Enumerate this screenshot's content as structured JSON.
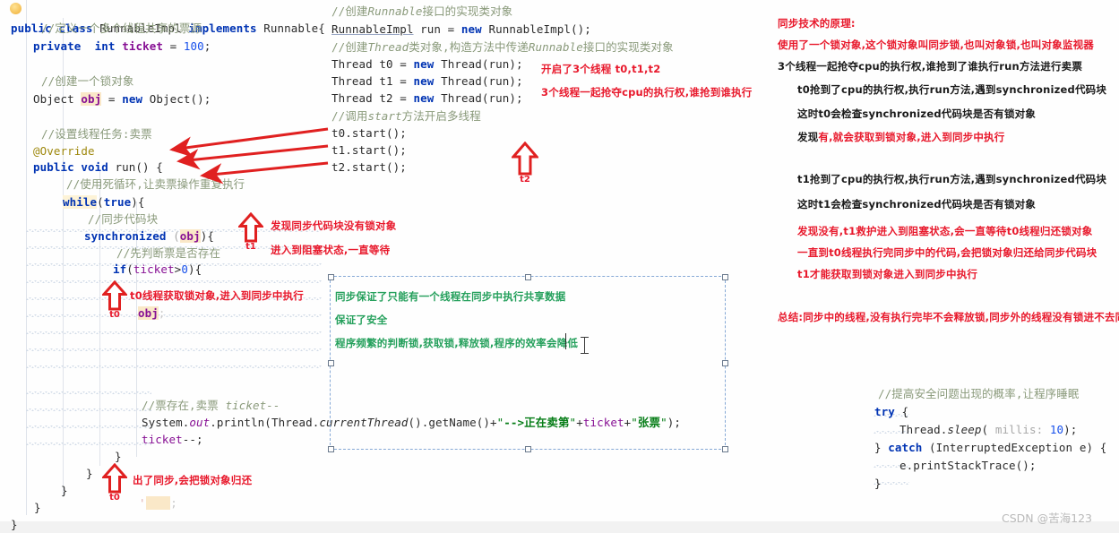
{
  "editor": {
    "left_code": [
      "public class RunnableImpl implements Runnable{",
      "    //定义一个多个线程共享的票源",
      "    private  int ticket = 100;",
      "",
      "    //创建一个锁对象",
      "    Object obj = new Object();",
      "",
      "    //设置线程任务:卖票",
      "    @Override",
      "    public void run() {",
      "        //使用死循环,让卖票操作重复执行",
      "        while(true){",
      "            //同步代码块",
      "            synchronized (obj){",
      "                //先判断票是否存在",
      "                if(ticket>0){",
      "",
      "                    //票存在,卖票 ticket--",
      "                    System.out.println(Thread.currentThread().getName()+\"-->正在卖第\"+ticket+\"张票\");",
      "                    ticket--;",
      "                }",
      "            }",
      "        }",
      "    }",
      "}"
    ],
    "middle_code": [
      "//创建Runnable接口的实现类对象",
      "RunnableImpl run = new RunnableImpl();",
      "//创建Thread类对象,构造方法中传递Runnable接口的实现类对象",
      "Thread t0 = new Thread(run);",
      "Thread t1 = new Thread(run);",
      "Thread t2 = new Thread(run);",
      "//调用start方法开启多线程",
      "t0.start();",
      "t1.start();",
      "t2.start();"
    ],
    "right_code": [
      "//提高安全问题出现的概率,让程序睡眠",
      "try {",
      "    Thread.sleep( millis: 10);",
      "} catch (InterruptedException e) {",
      "    e.printStackTrace();",
      "}"
    ],
    "sleep_param_hint": "millis:",
    "sleep_value": "10"
  },
  "annotations": {
    "middle_top": [
      "开启了3个线程 t0,t1,t2",
      "3个线程一起抢夺cpu的执行权,谁抢到谁执行"
    ],
    "t2_label": "t2",
    "t1_block": {
      "label": "t1",
      "lines": [
        "发现同步代码块没有锁对象",
        "进入到阻塞状态,一直等待"
      ]
    },
    "t0_lock": {
      "label": "t0",
      "text": "t0线程获取锁对象,进入到同步中执行",
      "code_hint": "obj"
    },
    "t0_release": {
      "label": "t0",
      "text": "出了同步,会把锁对象归还"
    }
  },
  "right_panel": {
    "title": "同步技术的原理:",
    "lines": [
      {
        "text": "使用了一个锁对象,这个锁对象叫同步锁,也叫对象锁,也叫对象监视器",
        "color": "red",
        "indent": 0
      },
      {
        "text": "3个线程一起抢夺cpu的执行权,谁抢到了谁执行run方法进行卖票",
        "color": "black",
        "indent": 0
      },
      {
        "text": "t0抢到了cpu的执行权,执行run方法,遇到synchronized代码块",
        "color": "black",
        "indent": 1
      },
      {
        "text": "这时t0会检查synchronized代码块是否有锁对象",
        "color": "black",
        "indent": 1
      },
      {
        "text": "发现有,就会获取到锁对象,进入到同步中执行",
        "color": "mixed",
        "indent": 1,
        "black_prefix": "发现"
      },
      {
        "text": "t1抢到了cpu的执行权,执行run方法,遇到synchronized代码块",
        "color": "black",
        "indent": 1
      },
      {
        "text": "这时t1会检查synchronized代码块是否有锁对象",
        "color": "black",
        "indent": 1
      },
      {
        "text": "发现没有,t1救护进入到阻塞状态,会一直等待t0线程归还锁对象",
        "color": "red",
        "indent": 1
      },
      {
        "text": "一直到t0线程执行完同步中的代码,会把锁对象归还给同步代码块",
        "color": "red",
        "indent": 1
      },
      {
        "text": "t1才能获取到锁对象进入到同步中执行",
        "color": "red",
        "indent": 1
      }
    ],
    "summary": "总结:同步中的线程,没有执行完毕不会释放锁,同步外的线程没有锁进不去同步"
  },
  "textbox": {
    "lines": [
      "同步保证了只能有一个线程在同步中执行共享数据",
      "保证了安全",
      "程序频繁的判断锁,获取锁,释放锁,程序的效率会降低"
    ]
  },
  "watermark": "CSDN @苦海123",
  "colors": {
    "annotation_red": "#e8192c",
    "comment_green": "#8a9a7b",
    "keyword_blue": "#0033b3",
    "field_purple": "#871094",
    "string_green": "#067d17",
    "textbox_green": "#25a05c",
    "selection_border": "#86a9d6"
  }
}
